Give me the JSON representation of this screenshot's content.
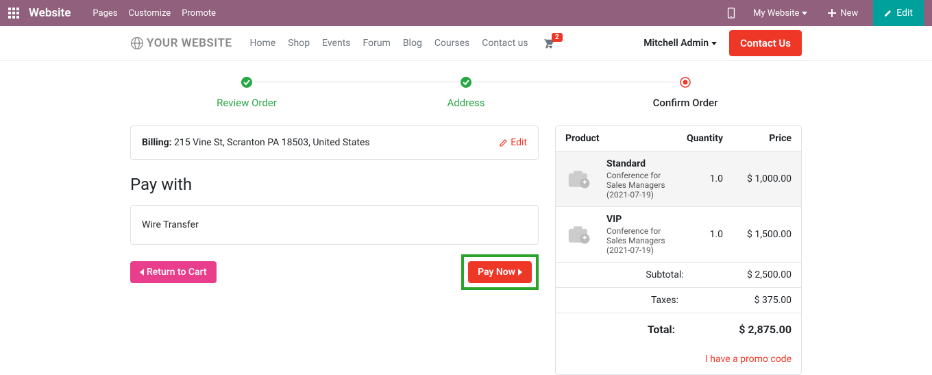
{
  "topbar": {
    "brand": "Website",
    "menu": [
      "Pages",
      "Customize",
      "Promote"
    ],
    "website_selector": "My Website",
    "new_label": "New",
    "edit_label": "Edit"
  },
  "siteheader": {
    "logo_text": "YOUR WEBSITE",
    "nav": [
      "Home",
      "Shop",
      "Events",
      "Forum",
      "Blog",
      "Courses",
      "Contact us"
    ],
    "cart_count": "2",
    "user_name": "Mitchell Admin",
    "contact_label": "Contact Us"
  },
  "steps": [
    {
      "label": "Review Order",
      "state": "done"
    },
    {
      "label": "Address",
      "state": "done"
    },
    {
      "label": "Confirm Order",
      "state": "current"
    }
  ],
  "billing": {
    "label": "Billing:",
    "address": "215 Vine St, Scranton PA 18503, United States",
    "edit_label": "Edit"
  },
  "pay_with_title": "Pay with",
  "pay_option": "Wire Transfer",
  "actions": {
    "return_label": "Return to Cart",
    "paynow_label": "Pay Now"
  },
  "summary": {
    "headers": {
      "product": "Product",
      "qty": "Quantity",
      "price": "Price"
    },
    "items": [
      {
        "name": "Standard",
        "desc": "Conference for Sales Managers (2021-07-19)",
        "qty": "1.0",
        "price": "$ 1,000.00"
      },
      {
        "name": "VIP",
        "desc": "Conference for Sales Managers (2021-07-19)",
        "qty": "1.0",
        "price": "$ 1,500.00"
      }
    ],
    "subtotal_label": "Subtotal:",
    "subtotal": "$ 2,500.00",
    "taxes_label": "Taxes:",
    "taxes": "$ 375.00",
    "total_label": "Total:",
    "total": "$ 2,875.00",
    "promo_label": "I have a promo code"
  }
}
